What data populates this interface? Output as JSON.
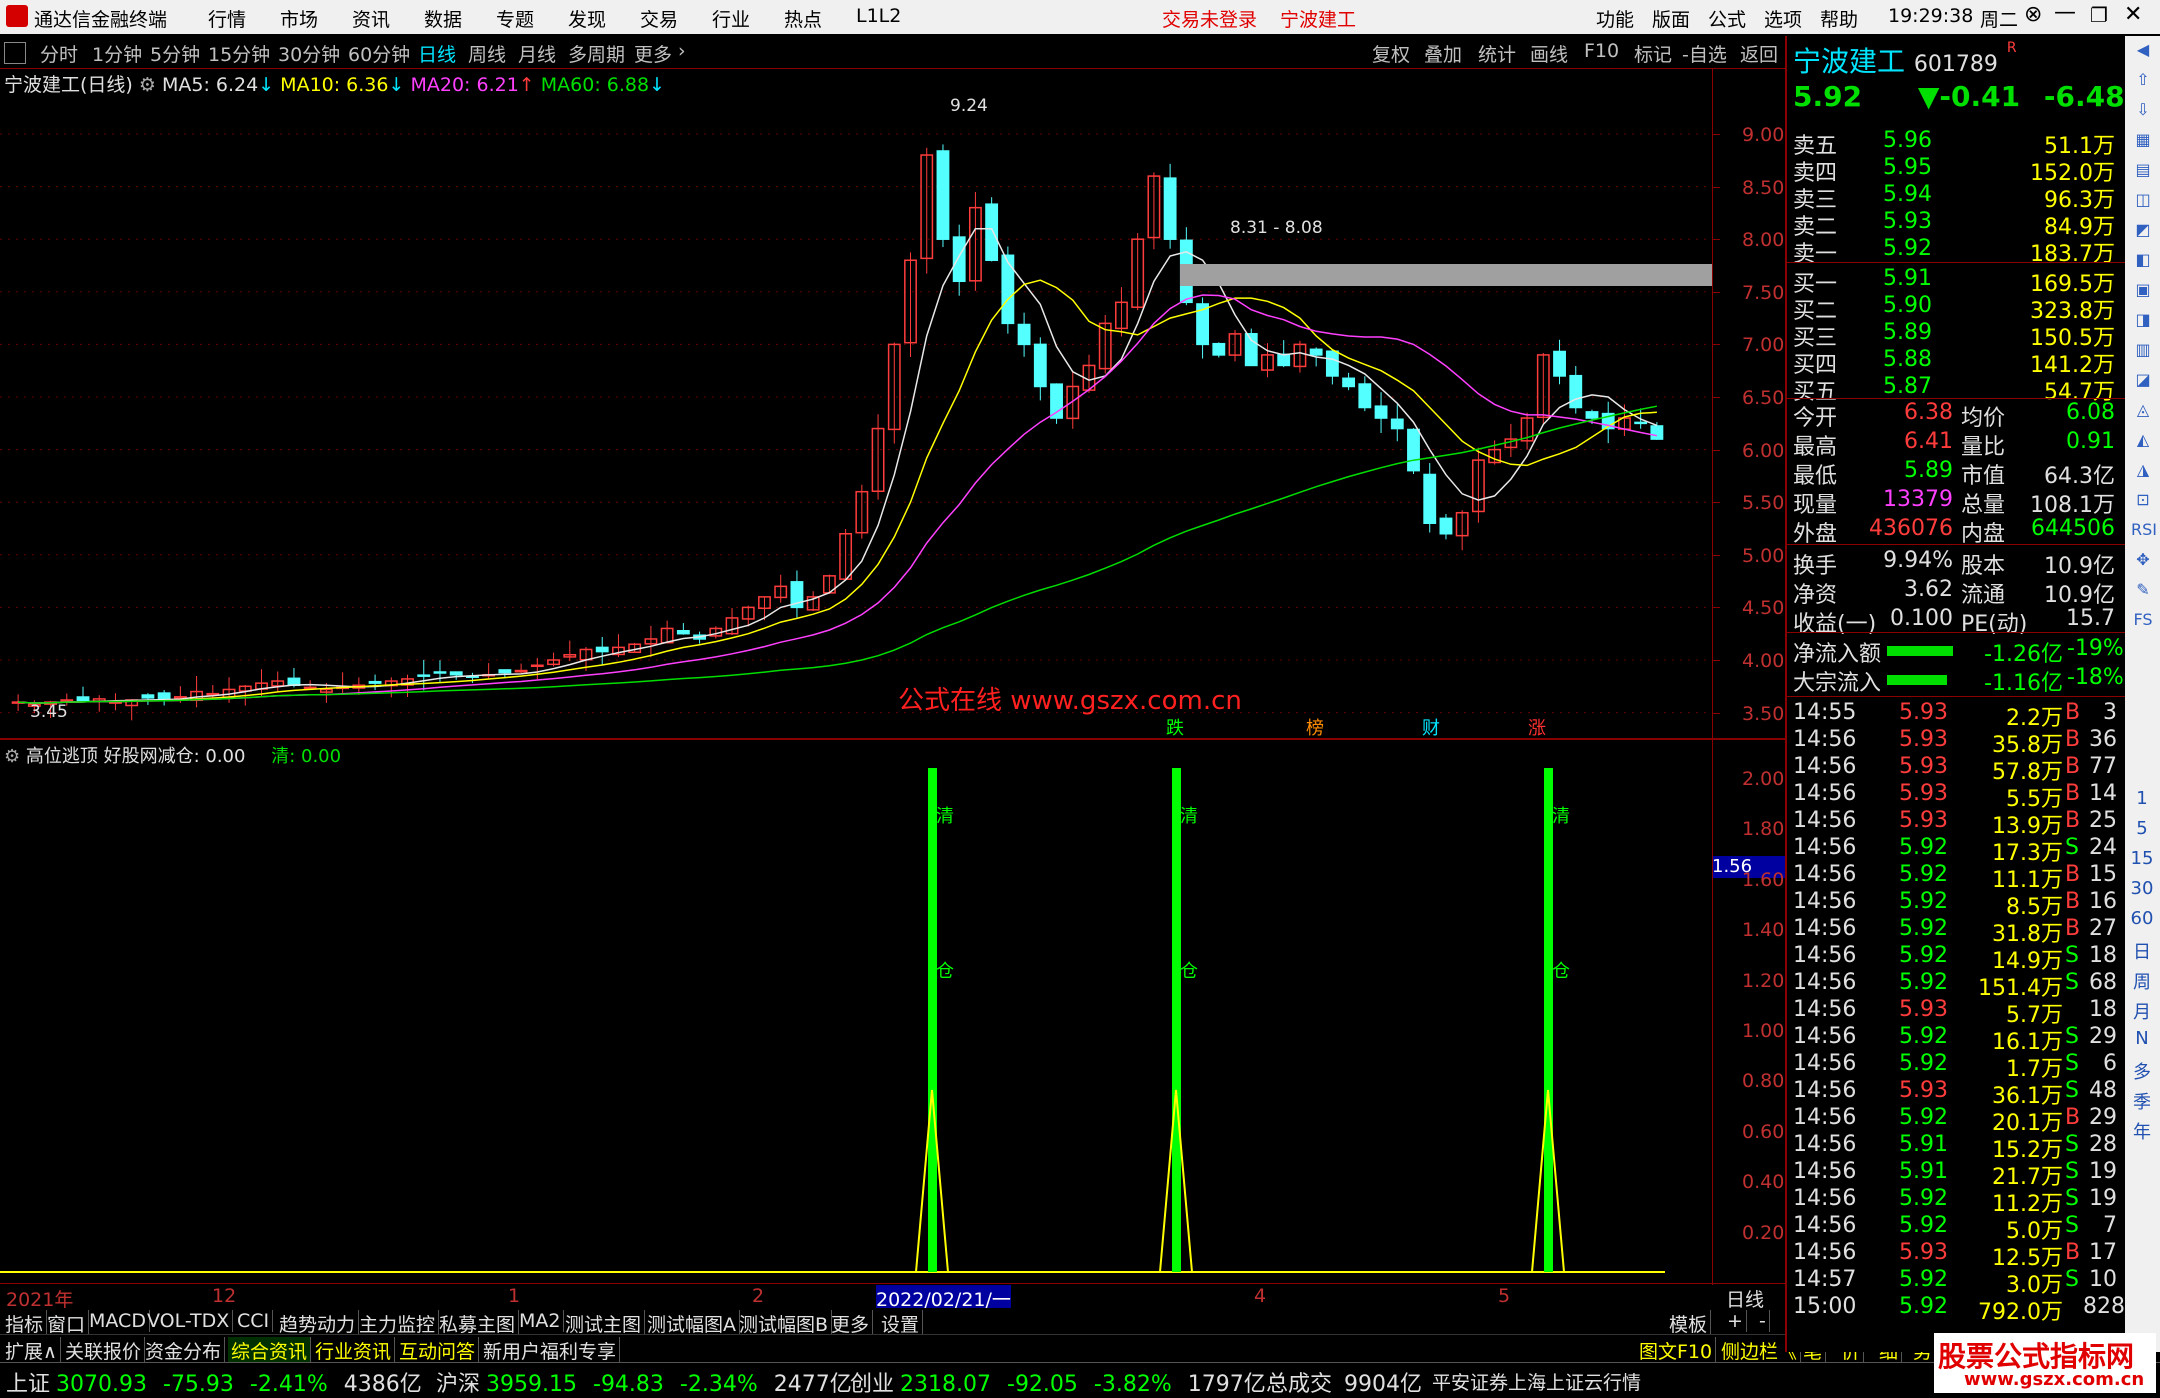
{
  "titlebar": {
    "app_name": "通达信金融终端",
    "menu": [
      "行情",
      "市场",
      "资讯",
      "数据",
      "专题",
      "发现",
      "交易",
      "行业",
      "热点",
      "L1L2"
    ],
    "status": "交易未登录",
    "stock": "宁波建工",
    "right_menu": [
      "功能",
      "版面",
      "公式",
      "选项",
      "帮助"
    ],
    "time": "19:29:38",
    "weekday": "周二"
  },
  "periods": [
    "分时",
    "1分钟",
    "5分钟",
    "15分钟",
    "30分钟",
    "60分钟",
    "日线",
    "周线",
    "月线",
    "多周期",
    "更多"
  ],
  "active_period": "日线",
  "chart_tools": [
    "复权",
    "叠加",
    "统计",
    "画线",
    "F10",
    "标记",
    "-自选",
    "返回"
  ],
  "ma_header": {
    "name": "宁波建工(日线)",
    "ma5": "MA5: 6.24",
    "ma10": "MA10: 6.36",
    "ma20": "MA20: 6.21",
    "ma60": "MA60: 6.88"
  },
  "annotations": {
    "high": "9.24",
    "range": "8.31 - 8.08",
    "low": "3.45",
    "watermark": "公式在线 www.gszx.com.cn",
    "events": [
      "跌",
      "榜",
      "财",
      "涨"
    ]
  },
  "price_axis": [
    "9.00",
    "8.50",
    "8.00",
    "7.50",
    "7.00",
    "6.50",
    "6.00",
    "5.50",
    "5.00",
    "4.50",
    "4.00",
    "3.50"
  ],
  "indicator": {
    "name": "高位逃顶 好股网减仓: 0.00",
    "value": "清: 0.00",
    "axis": [
      "2.00",
      "1.80",
      "1.60",
      "1.40",
      "1.20",
      "1.00",
      "0.80",
      "0.60",
      "0.40",
      "0.20"
    ],
    "marker": "1.56",
    "label_top": "清",
    "label_mid": "仓"
  },
  "date_axis": [
    "2021年",
    "12",
    "1",
    "2",
    "2022/02/21/一",
    "4",
    "5"
  ],
  "date_axis_right": "日线",
  "bottom_tabs": [
    "指标",
    "窗口",
    "MACD",
    "VOL-TDX",
    "CCI",
    "趋势动力",
    "主力监控",
    "私募主图",
    "MA2",
    "测试主图",
    "测试幅图A",
    "测试幅图B",
    "更多",
    "设置"
  ],
  "bottom_right": [
    "模板",
    "+",
    "-"
  ],
  "bottom_tabs2": [
    "扩展∧",
    "关联报价",
    "资金分布",
    "综合资讯",
    "行业资讯",
    "互动问答",
    "新用户福利专享"
  ],
  "bottom_tabs2_right": [
    "图文F10",
    "侧边栏《",
    "笔",
    "价",
    "细",
    "势"
  ],
  "quote": {
    "name": "宁波建工",
    "code": "601789",
    "price": "5.92",
    "change": "▼-0.41",
    "pct": "-6.48%",
    "asks": [
      {
        "label": "卖五",
        "p": "5.96",
        "v": "51.1万"
      },
      {
        "label": "卖四",
        "p": "5.95",
        "v": "152.0万"
      },
      {
        "label": "卖三",
        "p": "5.94",
        "v": "96.3万"
      },
      {
        "label": "卖二",
        "p": "5.93",
        "v": "84.9万"
      },
      {
        "label": "卖一",
        "p": "5.92",
        "v": "183.7万"
      }
    ],
    "bids": [
      {
        "label": "买一",
        "p": "5.91",
        "v": "169.5万"
      },
      {
        "label": "买二",
        "p": "5.90",
        "v": "323.8万"
      },
      {
        "label": "买三",
        "p": "5.89",
        "v": "150.5万"
      },
      {
        "label": "买四",
        "p": "5.88",
        "v": "141.2万"
      },
      {
        "label": "买五",
        "p": "5.87",
        "v": "54.7万"
      }
    ],
    "stats": [
      [
        "今开",
        "6.38",
        "均价",
        "6.08"
      ],
      [
        "最高",
        "6.41",
        "量比",
        "0.91"
      ],
      [
        "最低",
        "5.89",
        "市值",
        "64.3亿"
      ],
      [
        "现量",
        "13379",
        "总量",
        "108.1万"
      ],
      [
        "外盘",
        "436076",
        "内盘",
        "644506"
      ],
      [
        "换手",
        "9.94%",
        "股本",
        "10.9亿"
      ],
      [
        "净资",
        "3.62",
        "流通",
        "10.9亿"
      ],
      [
        "收益(一)",
        "0.100",
        "PE(动)",
        "15.7"
      ]
    ],
    "flows": [
      [
        "净流入额",
        "-1.26亿",
        "-19%"
      ],
      [
        "大宗流入",
        "-1.16亿",
        "-18%"
      ]
    ],
    "ticks": [
      [
        "14:55",
        "5.93",
        "2.2万",
        "B",
        "3"
      ],
      [
        "14:56",
        "5.93",
        "35.8万",
        "B",
        "36"
      ],
      [
        "14:56",
        "5.93",
        "57.8万",
        "B",
        "77"
      ],
      [
        "14:56",
        "5.93",
        "5.5万",
        "B",
        "14"
      ],
      [
        "14:56",
        "5.93",
        "13.9万",
        "B",
        "25"
      ],
      [
        "14:56",
        "5.92",
        "17.3万",
        "S",
        "24"
      ],
      [
        "14:56",
        "5.92",
        "11.1万",
        "B",
        "15"
      ],
      [
        "14:56",
        "5.92",
        "8.5万",
        "B",
        "16"
      ],
      [
        "14:56",
        "5.92",
        "31.8万",
        "B",
        "27"
      ],
      [
        "14:56",
        "5.92",
        "14.9万",
        "S",
        "18"
      ],
      [
        "14:56",
        "5.92",
        "151.4万",
        "S",
        "68"
      ],
      [
        "14:56",
        "5.93",
        "5.7万",
        "",
        "18"
      ],
      [
        "14:56",
        "5.92",
        "16.1万",
        "S",
        "29"
      ],
      [
        "14:56",
        "5.92",
        "1.7万",
        "S",
        "6"
      ],
      [
        "14:56",
        "5.93",
        "36.1万",
        "S",
        "48"
      ],
      [
        "14:56",
        "5.92",
        "20.1万",
        "B",
        "29"
      ],
      [
        "14:56",
        "5.91",
        "15.2万",
        "S",
        "28"
      ],
      [
        "14:56",
        "5.91",
        "21.7万",
        "S",
        "19"
      ],
      [
        "14:56",
        "5.92",
        "11.2万",
        "S",
        "19"
      ],
      [
        "14:56",
        "5.92",
        "5.0万",
        "S",
        "7"
      ],
      [
        "14:56",
        "5.93",
        "12.5万",
        "B",
        "17"
      ],
      [
        "14:57",
        "5.92",
        "3.0万",
        "S",
        "10"
      ],
      [
        "15:00",
        "5.92",
        "792.0万",
        "",
        "828"
      ]
    ]
  },
  "sidebar_labels": [
    "1",
    "5",
    "15",
    "30",
    "60",
    "日",
    "周",
    "月",
    "N",
    "多",
    "季",
    "年"
  ],
  "statusbar": {
    "items": [
      {
        "name": "上证",
        "v": "3070.93",
        "c": "-75.93",
        "p": "-2.41%",
        "a": "4386亿"
      },
      {
        "name": "沪深",
        "v": "3959.15",
        "c": "-94.83",
        "p": "-2.34%",
        "a": "2477亿"
      },
      {
        "name": "创业",
        "v": "2318.07",
        "c": "-92.05",
        "p": "-3.82%",
        "a": "1797亿"
      }
    ],
    "total_label": "总成交",
    "total": "9904亿",
    "broker": "平安证券上海上证云行情",
    "watermark": "股票公式指标网",
    "watermark_url": "www.gszx.com.cn"
  }
}
